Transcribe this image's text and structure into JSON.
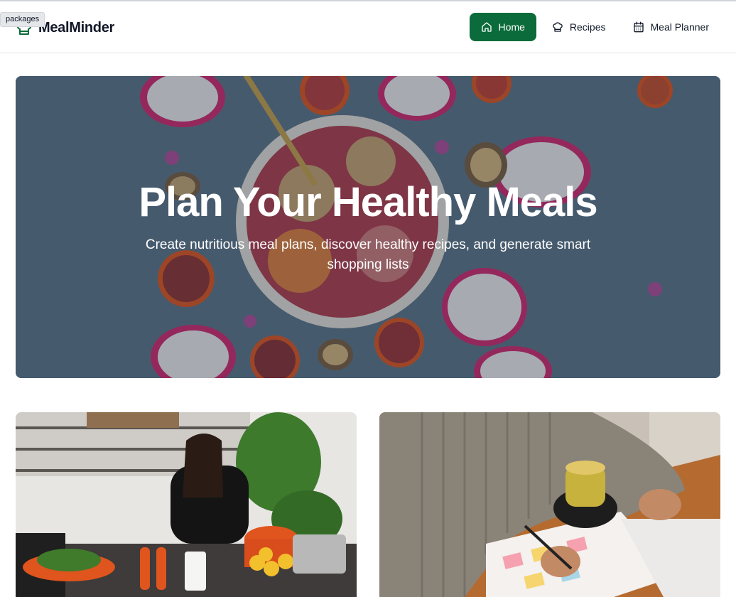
{
  "tooltip": "packages",
  "brand": {
    "name": "MealMinder",
    "icon": "chef-hat-icon"
  },
  "nav": [
    {
      "label": "Home",
      "icon": "home-icon",
      "active": true
    },
    {
      "label": "Recipes",
      "icon": "chef-hat-icon",
      "active": false
    },
    {
      "label": "Meal Planner",
      "icon": "calendar-icon",
      "active": false
    }
  ],
  "hero": {
    "title": "Plan Your Healthy Meals",
    "subtitle": "Create nutritious meal plans, discover healthy recipes, and generate smart shopping lists"
  },
  "colors": {
    "accent": "#0b6b3a",
    "hero_bg": "#50647a"
  }
}
